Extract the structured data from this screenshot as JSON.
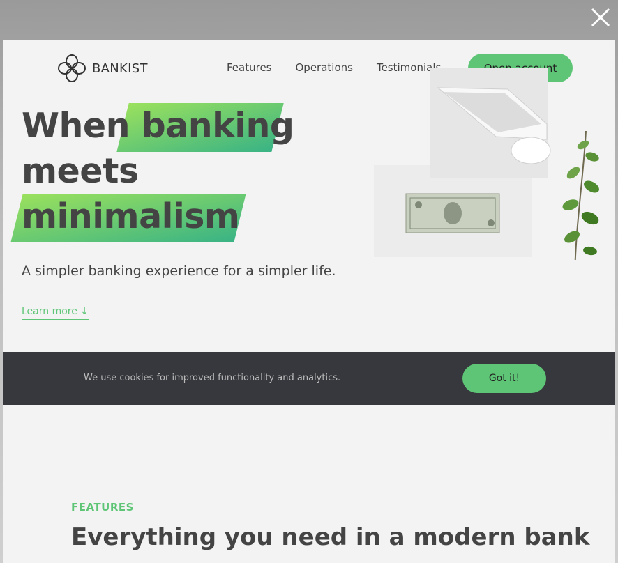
{
  "close_label": "×",
  "nav": {
    "logo_text": "BANKIST",
    "links": [
      "Features",
      "Operations",
      "Testimonials"
    ],
    "cta": "Open account"
  },
  "hero": {
    "line1_plain": "When",
    "line1_highlight": "banking",
    "line2": "meets",
    "line3_highlight": "minimalism",
    "subtitle": "A simpler banking experience for a simpler life.",
    "learn_more": "Learn more ↓"
  },
  "cookie": {
    "message": "We use cookies for improved functionality and analytics.",
    "button": "Got it!"
  },
  "features": {
    "label": "FEATURES",
    "title": "Everything you need in a modern bank"
  },
  "colors": {
    "accent": "#5ec576",
    "dark_bar": "#37383d",
    "text": "#444444",
    "page_bg": "#f3f3f3"
  }
}
